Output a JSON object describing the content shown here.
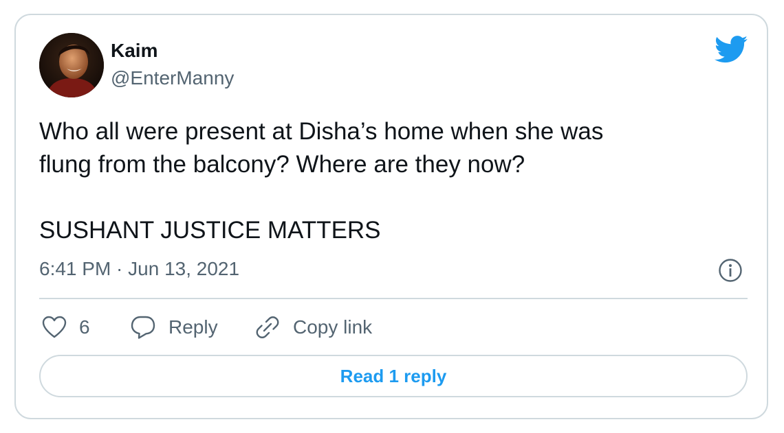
{
  "author": {
    "name": "Kaim",
    "handle": "@EnterManny"
  },
  "tweet": {
    "text": "Who all were present at Disha’s home when she was\nflung from the balcony? Where are they now?\n\nSUSHANT JUSTICE MATTERS",
    "timestamp": "6:41 PM · Jun 13, 2021"
  },
  "actions": {
    "like_count": "6",
    "reply_label": "Reply",
    "copy_link_label": "Copy link"
  },
  "read_replies_label": "Read 1 reply",
  "icons": {
    "brand": "twitter-bird-icon",
    "info": "info-icon",
    "like": "heart-icon",
    "reply": "speech-bubble-icon",
    "copy": "link-icon"
  },
  "colors": {
    "accent": "#1d9bf0",
    "text": "#0f1419",
    "secondary_text": "#536471",
    "border": "#cfd9de"
  }
}
